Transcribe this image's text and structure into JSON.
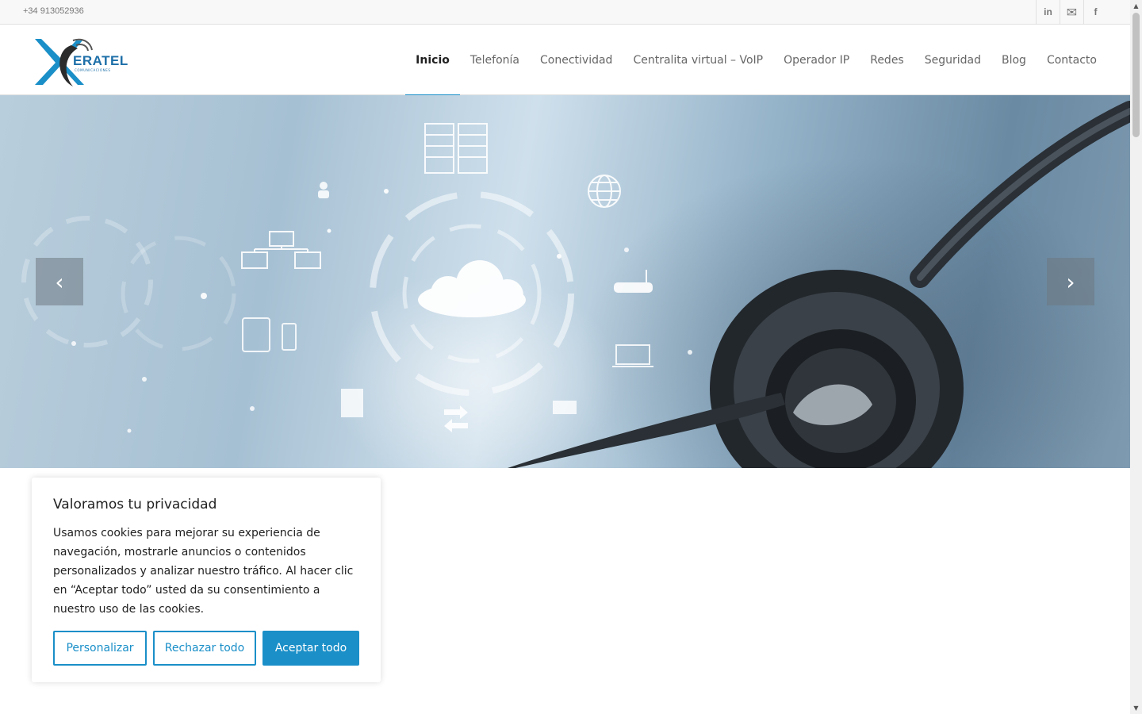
{
  "topbar": {
    "phone": "+34 913052936",
    "social": [
      {
        "icon": "linkedin-icon",
        "glyph": "in"
      },
      {
        "icon": "mail-icon",
        "glyph": "✉"
      },
      {
        "icon": "facebook-icon",
        "glyph": "f"
      }
    ]
  },
  "header": {
    "logo_text": "ERATEL",
    "logo_sub": "COMUNICACIONES",
    "nav": [
      {
        "label": "Inicio",
        "active": true
      },
      {
        "label": "Telefonía"
      },
      {
        "label": "Conectividad"
      },
      {
        "label": "Centralita virtual – VoIP"
      },
      {
        "label": "Operador IP"
      },
      {
        "label": "Redes"
      },
      {
        "label": "Seguridad"
      },
      {
        "label": "Blog"
      },
      {
        "label": "Contacto"
      }
    ]
  },
  "slider": {
    "prev_glyph": "‹",
    "next_glyph": "›"
  },
  "cookie": {
    "title": "Valoramos tu privacidad",
    "text": "Usamos cookies para mejorar su experiencia de navegación, mostrarle anuncios o contenidos personalizados y analizar nuestro tráfico. Al hacer clic en “Aceptar todo” usted da su consentimiento a nuestro uso de las cookies.",
    "customize": "Personalizar",
    "reject": "Rechazar todo",
    "accept": "Aceptar todo"
  },
  "colors": {
    "accent": "#1a8fc8",
    "logo": "#1d6fa8"
  }
}
